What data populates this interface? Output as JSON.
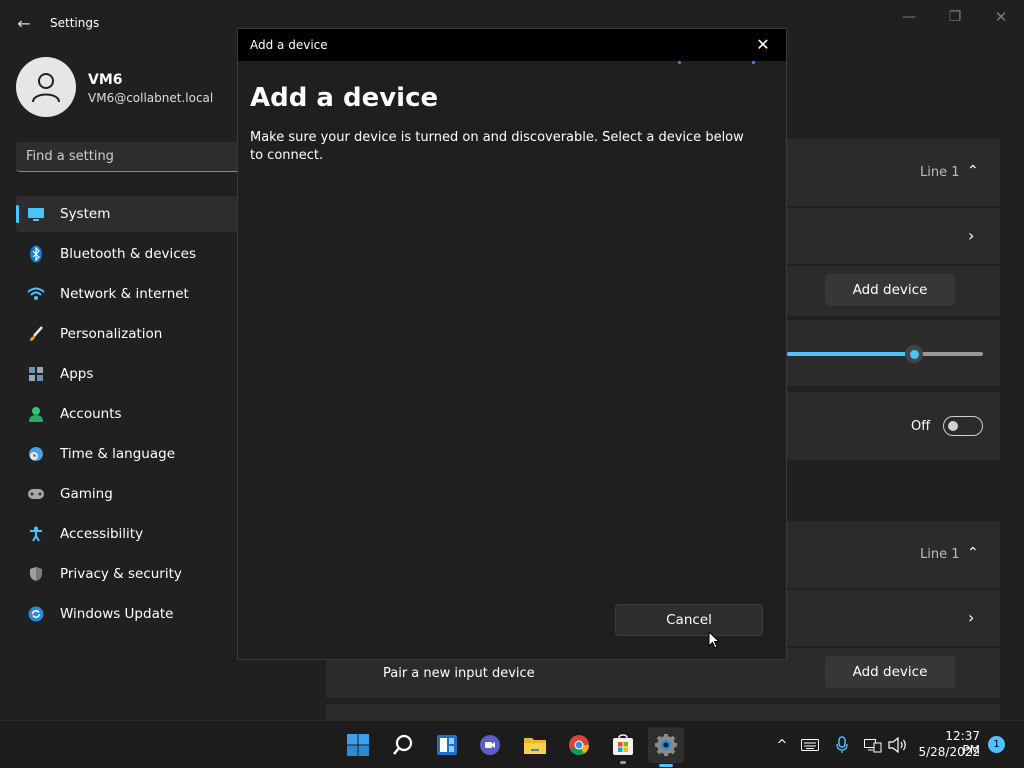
{
  "app": {
    "title": "Settings",
    "back_glyph": "←",
    "minimize_glyph": "—",
    "maximize_glyph": "❐",
    "close_glyph": "✕"
  },
  "profile": {
    "name": "VM6",
    "email": "VM6@collabnet.local"
  },
  "search": {
    "placeholder": "Find a setting"
  },
  "sidebar": {
    "items": [
      {
        "label": "System",
        "icon": "monitor-icon",
        "selected": true
      },
      {
        "label": "Bluetooth & devices",
        "icon": "bluetooth-icon"
      },
      {
        "label": "Network & internet",
        "icon": "wifi-icon"
      },
      {
        "label": "Personalization",
        "icon": "brush-icon"
      },
      {
        "label": "Apps",
        "icon": "apps-icon"
      },
      {
        "label": "Accounts",
        "icon": "person-icon"
      },
      {
        "label": "Time & language",
        "icon": "clock-globe-icon"
      },
      {
        "label": "Gaming",
        "icon": "gamepad-icon"
      },
      {
        "label": "Accessibility",
        "icon": "accessibility-icon"
      },
      {
        "label": "Privacy & security",
        "icon": "shield-icon"
      },
      {
        "label": "Windows Update",
        "icon": "update-icon"
      }
    ]
  },
  "background": {
    "line1_top": "Line 1",
    "add_device_top": "Add device",
    "toggle_label": "Off",
    "slider_value": 0.65,
    "line1_bottom": "Line 1",
    "pair_input_label": "Pair a new input device",
    "add_device_bottom": "Add device"
  },
  "dialog": {
    "window_title": "Add a device",
    "heading": "Add a device",
    "description": "Make sure your device is turned on and discoverable. Select a device below to connect.",
    "cancel_label": "Cancel",
    "close_glyph": "✕"
  },
  "taskbar": {
    "apps": [
      {
        "name": "start-icon"
      },
      {
        "name": "search-icon"
      },
      {
        "name": "widgets-icon"
      },
      {
        "name": "chat-icon"
      },
      {
        "name": "file-explorer-icon"
      },
      {
        "name": "chrome-icon"
      },
      {
        "name": "store-icon"
      },
      {
        "name": "settings-icon",
        "active": true
      }
    ],
    "time": "12:37 PM",
    "date": "5/28/2022",
    "notification_count": "1",
    "tray_chevron": "^"
  },
  "colors": {
    "accent": "#4cc2ff",
    "background": "#202020",
    "card": "#2b2b2b",
    "dialog_titlebar": "#000000"
  }
}
